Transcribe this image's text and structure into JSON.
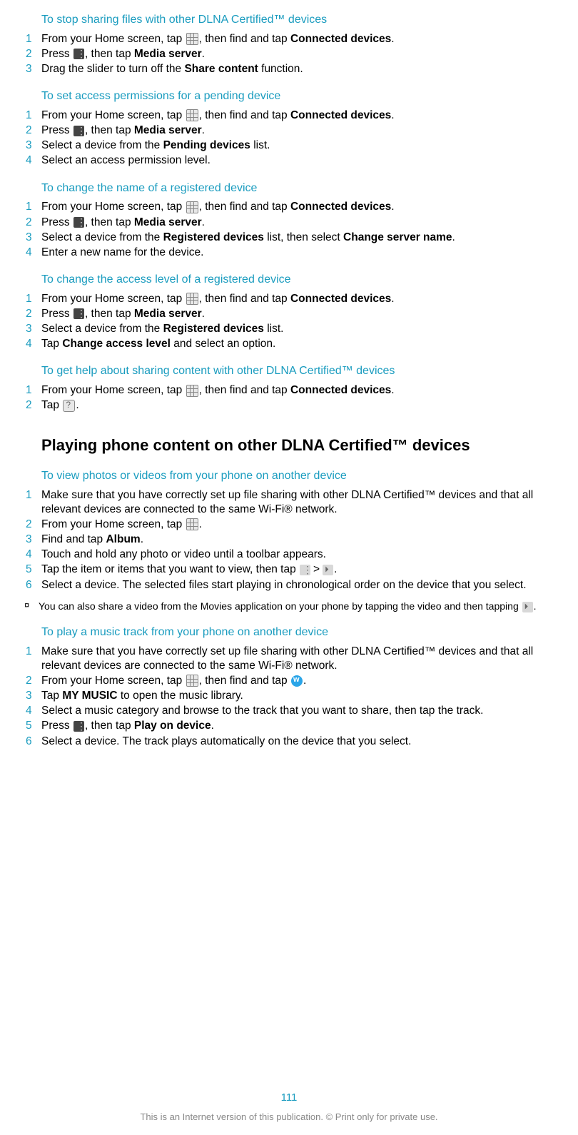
{
  "sections": [
    {
      "title": "To stop sharing files with other DLNA Certified™ devices",
      "steps": [
        {
          "n": "1",
          "parts": [
            {
              "t": "From your Home screen, tap "
            },
            {
              "icon": "grid"
            },
            {
              "t": ", then find and tap "
            },
            {
              "b": "Connected devices"
            },
            {
              "t": "."
            }
          ]
        },
        {
          "n": "2",
          "parts": [
            {
              "t": "Press "
            },
            {
              "icon": "menu"
            },
            {
              "t": ", then tap "
            },
            {
              "b": "Media server"
            },
            {
              "t": "."
            }
          ]
        },
        {
          "n": "3",
          "parts": [
            {
              "t": "Drag the slider to turn off the "
            },
            {
              "b": "Share content"
            },
            {
              "t": " function."
            }
          ]
        }
      ]
    },
    {
      "title": "To set access permissions for a pending device",
      "steps": [
        {
          "n": "1",
          "parts": [
            {
              "t": "From your Home screen, tap "
            },
            {
              "icon": "grid"
            },
            {
              "t": ", then find and tap "
            },
            {
              "b": "Connected devices"
            },
            {
              "t": "."
            }
          ]
        },
        {
          "n": "2",
          "parts": [
            {
              "t": "Press "
            },
            {
              "icon": "menu"
            },
            {
              "t": ", then tap "
            },
            {
              "b": "Media server"
            },
            {
              "t": "."
            }
          ]
        },
        {
          "n": "3",
          "parts": [
            {
              "t": "Select a device from the "
            },
            {
              "b": "Pending devices"
            },
            {
              "t": " list."
            }
          ]
        },
        {
          "n": "4",
          "parts": [
            {
              "t": "Select an access permission level."
            }
          ]
        }
      ]
    },
    {
      "title": "To change the name of a registered device",
      "steps": [
        {
          "n": "1",
          "parts": [
            {
              "t": "From your Home screen, tap "
            },
            {
              "icon": "grid"
            },
            {
              "t": ", then find and tap "
            },
            {
              "b": "Connected devices"
            },
            {
              "t": "."
            }
          ]
        },
        {
          "n": "2",
          "parts": [
            {
              "t": "Press "
            },
            {
              "icon": "menu"
            },
            {
              "t": ", then tap "
            },
            {
              "b": "Media server"
            },
            {
              "t": "."
            }
          ]
        },
        {
          "n": "3",
          "parts": [
            {
              "t": "Select a device from the "
            },
            {
              "b": "Registered devices"
            },
            {
              "t": " list, then select "
            },
            {
              "b": "Change server name"
            },
            {
              "t": "."
            }
          ]
        },
        {
          "n": "4",
          "parts": [
            {
              "t": "Enter a new name for the device."
            }
          ]
        }
      ]
    },
    {
      "title": "To change the access level of a registered device",
      "steps": [
        {
          "n": "1",
          "parts": [
            {
              "t": "From your Home screen, tap "
            },
            {
              "icon": "grid"
            },
            {
              "t": ", then find and tap "
            },
            {
              "b": "Connected devices"
            },
            {
              "t": "."
            }
          ]
        },
        {
          "n": "2",
          "parts": [
            {
              "t": "Press "
            },
            {
              "icon": "menu"
            },
            {
              "t": ", then tap "
            },
            {
              "b": "Media server"
            },
            {
              "t": "."
            }
          ]
        },
        {
          "n": "3",
          "parts": [
            {
              "t": "Select a device from the "
            },
            {
              "b": "Registered devices"
            },
            {
              "t": " list."
            }
          ]
        },
        {
          "n": "4",
          "parts": [
            {
              "t": "Tap "
            },
            {
              "b": "Change access level"
            },
            {
              "t": " and select an option."
            }
          ]
        }
      ]
    },
    {
      "title": "To get help about sharing content with other DLNA Certified™ devices",
      "steps": [
        {
          "n": "1",
          "parts": [
            {
              "t": "From your Home screen, tap "
            },
            {
              "icon": "grid"
            },
            {
              "t": ", then find and tap "
            },
            {
              "b": "Connected devices"
            },
            {
              "t": "."
            }
          ]
        },
        {
          "n": "2",
          "parts": [
            {
              "t": "Tap "
            },
            {
              "icon": "help"
            },
            {
              "t": "."
            }
          ]
        }
      ]
    }
  ],
  "mainHeading": "Playing phone content on other DLNA Certified™ devices",
  "sections2": [
    {
      "title": "To view photos or videos from your phone on another device",
      "steps": [
        {
          "n": "1",
          "parts": [
            {
              "t": "Make sure that you have correctly set up file sharing with other DLNA Certified™ devices and that all relevant devices are connected to the same Wi-Fi® network."
            }
          ]
        },
        {
          "n": "2",
          "parts": [
            {
              "t": "From your Home screen, tap "
            },
            {
              "icon": "grid"
            },
            {
              "t": "."
            }
          ]
        },
        {
          "n": "3",
          "parts": [
            {
              "t": "Find and tap "
            },
            {
              "b": "Album"
            },
            {
              "t": "."
            }
          ]
        },
        {
          "n": "4",
          "parts": [
            {
              "t": "Touch and hold any photo or video until a toolbar appears."
            }
          ]
        },
        {
          "n": "5",
          "parts": [
            {
              "t": "Tap the item or items that you want to view, then tap "
            },
            {
              "icon": "dots"
            },
            {
              "gt": ">"
            },
            {
              "icon": "throw"
            },
            {
              "t": "."
            }
          ]
        },
        {
          "n": "6",
          "parts": [
            {
              "t": "Select a device. The selected files start playing in chronological order on the device that you select."
            }
          ]
        }
      ],
      "tip": {
        "parts": [
          {
            "t": "You can also share a video from the Movies application on your phone by tapping the video and then tapping "
          },
          {
            "icon": "throw"
          },
          {
            "t": "."
          }
        ]
      }
    },
    {
      "title": "To play a music track from your phone on another device",
      "steps": [
        {
          "n": "1",
          "parts": [
            {
              "t": "Make sure that you have correctly set up file sharing with other DLNA Certified™ devices and that all relevant devices are connected to the same Wi-Fi® network."
            }
          ]
        },
        {
          "n": "2",
          "parts": [
            {
              "t": "From your Home screen, tap "
            },
            {
              "icon": "grid"
            },
            {
              "t": ", then find and tap "
            },
            {
              "icon": "walkman"
            },
            {
              "t": "."
            }
          ]
        },
        {
          "n": "3",
          "parts": [
            {
              "t": "Tap "
            },
            {
              "b": "MY MUSIC"
            },
            {
              "t": " to open the music library."
            }
          ]
        },
        {
          "n": "4",
          "parts": [
            {
              "t": "Select a music category and browse to the track that you want to share, then tap the track."
            }
          ]
        },
        {
          "n": "5",
          "parts": [
            {
              "t": "Press "
            },
            {
              "icon": "menu"
            },
            {
              "t": ", then tap "
            },
            {
              "b": "Play on device"
            },
            {
              "t": "."
            }
          ]
        },
        {
          "n": "6",
          "parts": [
            {
              "t": "Select a device. The track plays automatically on the device that you select."
            }
          ]
        }
      ]
    }
  ],
  "pageNumber": "111",
  "disclaimer": "This is an Internet version of this publication. © Print only for private use.",
  "tipIcon": "💡"
}
